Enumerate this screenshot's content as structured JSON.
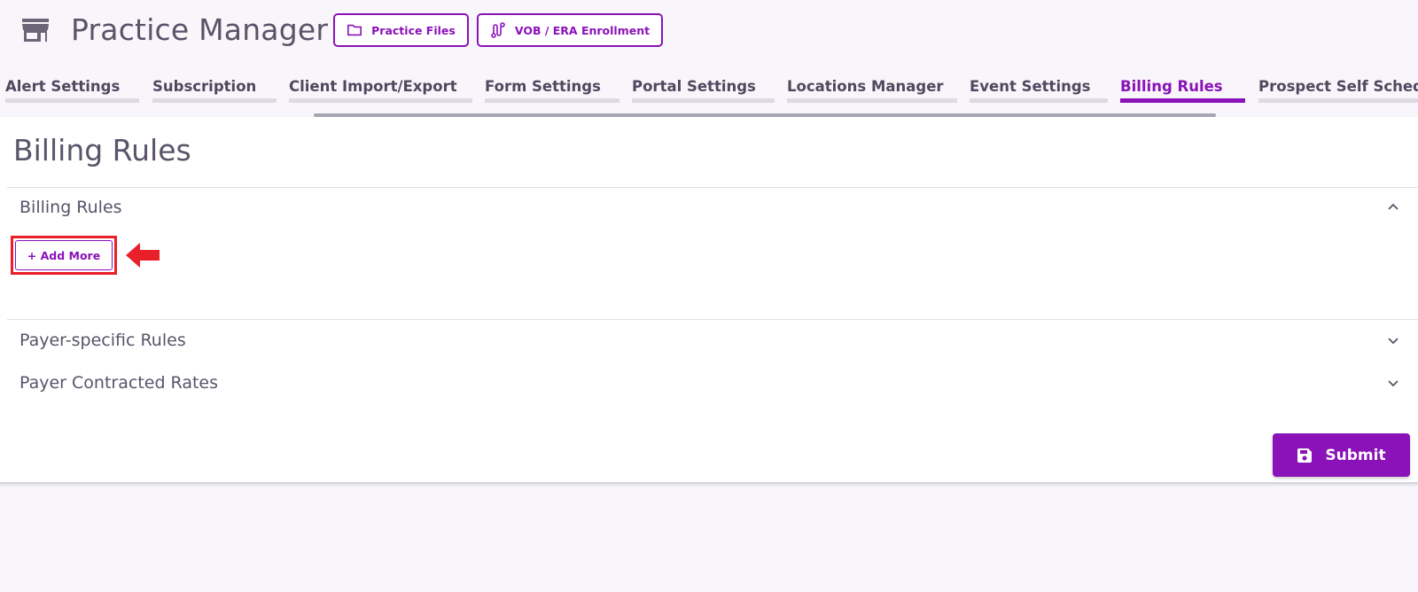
{
  "header": {
    "title": "Practice Manager",
    "icon": "store-icon",
    "buttons": {
      "practice_files": "Practice Files",
      "vob_era": "VOB / ERA Enrollment"
    }
  },
  "tabs": [
    {
      "label": "Alert Settings",
      "active": false
    },
    {
      "label": "Subscription",
      "active": false
    },
    {
      "label": "Client Import/Export",
      "active": false
    },
    {
      "label": "Form Settings",
      "active": false
    },
    {
      "label": "Portal Settings",
      "active": false
    },
    {
      "label": "Locations Manager",
      "active": false
    },
    {
      "label": "Event Settings",
      "active": false
    },
    {
      "label": "Billing Rules",
      "active": true
    },
    {
      "label": "Prospect Self Schedule",
      "active": false
    }
  ],
  "main": {
    "page_title": "Billing Rules",
    "sections": [
      {
        "title": "Billing Rules",
        "expanded": true,
        "add_more_label": "+ Add More"
      },
      {
        "title": "Payer-specific Rules",
        "expanded": false
      },
      {
        "title": "Payer Contracted Rates",
        "expanded": false
      }
    ],
    "submit_label": "Submit"
  },
  "colors": {
    "accent": "#8a12b8",
    "highlight": "#e8202a",
    "text": "#5a5369",
    "background": "#f8f6fa"
  }
}
